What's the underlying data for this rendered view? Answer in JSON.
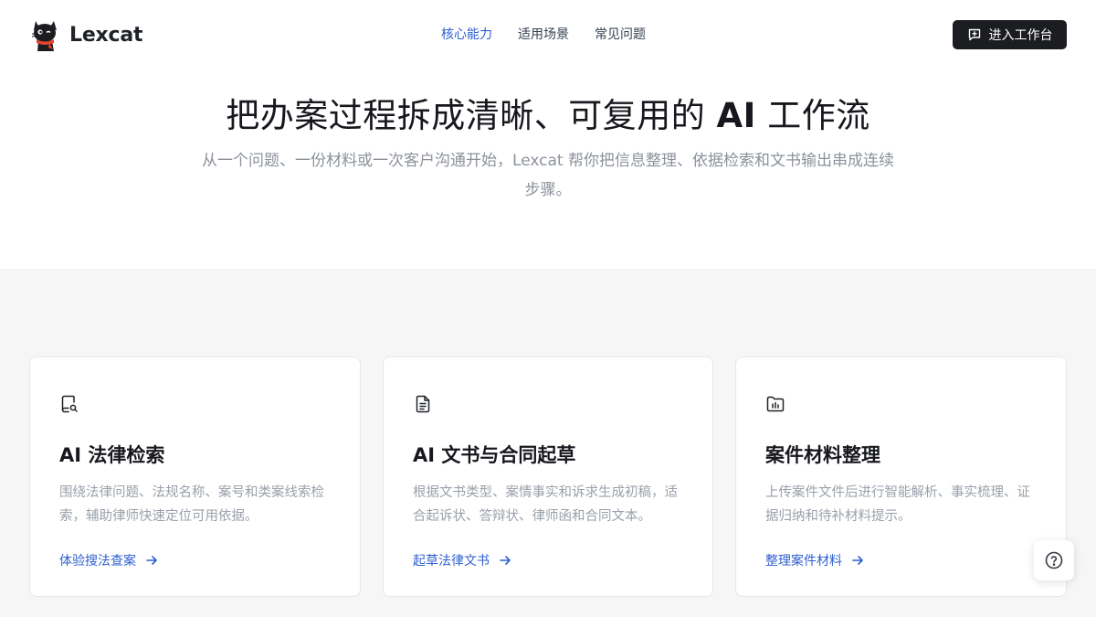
{
  "brand": {
    "name": "Lexcat"
  },
  "nav": {
    "items": [
      {
        "label": "核心能力",
        "active": true
      },
      {
        "label": "适用场景",
        "active": false
      },
      {
        "label": "常见问题",
        "active": false
      }
    ]
  },
  "header": {
    "cta_label": "进入工作台",
    "cta_icon": "message-plus-icon"
  },
  "hero": {
    "title_prefix": "把办案过程拆成清晰、可复用的 ",
    "title_highlight": "AI",
    "title_suffix": " 工作流",
    "subtitle": "从一个问题、一份材料或一次客户沟通开始，Lexcat 帮你把信息整理、依据检索和文书输出串成连续步骤。"
  },
  "features": [
    {
      "icon": "book-search-icon",
      "title": "AI 法律检索",
      "description": "围绕法律问题、法规名称、案号和类案线索检索，辅助律师快速定位可用依据。",
      "link_label": "体验搜法查案"
    },
    {
      "icon": "document-text-icon",
      "title": "AI 文书与合同起草",
      "description": "根据文书类型、案情事实和诉求生成初稿，适合起诉状、答辩状、律师函和合同文本。",
      "link_label": "起草法律文书"
    },
    {
      "icon": "folder-chart-icon",
      "title": "案件材料整理",
      "description": "上传案件文件后进行智能解析、事实梳理、证据归纳和待补材料提示。",
      "link_label": "整理案件材料"
    }
  ],
  "help": {
    "icon": "question-circle-icon"
  },
  "colors": {
    "accent": "#2f5fd0",
    "dark": "#1c1d21",
    "section_bg": "#f6f6f7",
    "muted_text": "#9aa0aa",
    "cat_scarf": "#e8432c"
  }
}
